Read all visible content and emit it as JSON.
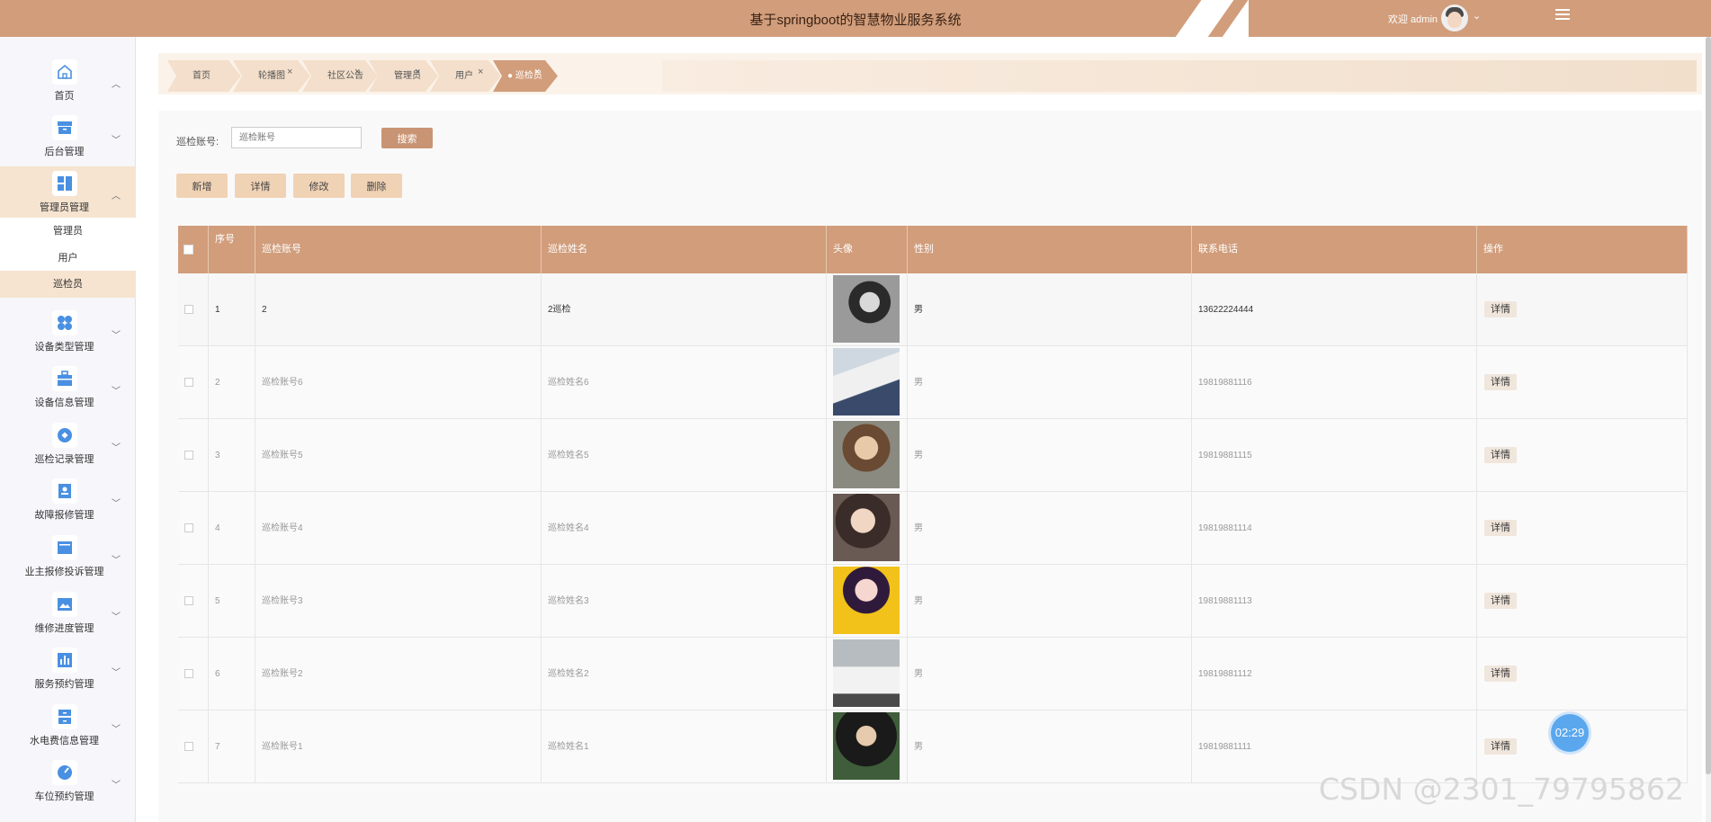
{
  "header": {
    "title": "基于springboot的智慧物业服务系统",
    "welcome": "欢迎 admin"
  },
  "sidebar": {
    "items": [
      {
        "label": "首页",
        "icon": "home-icon",
        "arrow": "^"
      },
      {
        "label": "后台管理",
        "icon": "box-icon",
        "arrow": "v"
      },
      {
        "label": "管理员管理",
        "icon": "grid-icon",
        "arrow": "^"
      },
      {
        "label": "设备类型管理",
        "icon": "dots-grid-icon",
        "arrow": "v"
      },
      {
        "label": "设备信息管理",
        "icon": "briefcase-icon",
        "arrow": "v"
      },
      {
        "label": "巡检记录管理",
        "icon": "target-icon",
        "arrow": "v"
      },
      {
        "label": "故障报修管理",
        "icon": "id-card-icon",
        "arrow": "v"
      },
      {
        "label": "业主报修投诉管理",
        "icon": "window-icon",
        "arrow": "v"
      },
      {
        "label": "维修进度管理",
        "icon": "image-icon",
        "arrow": "v"
      },
      {
        "label": "服务预约管理",
        "icon": "bar-chart-icon",
        "arrow": "v"
      },
      {
        "label": "水电费信息管理",
        "icon": "cabinet-icon",
        "arrow": "v"
      },
      {
        "label": "车位预约管理",
        "icon": "gauge-icon",
        "arrow": "v"
      }
    ],
    "sub_items": [
      "管理员",
      "用户",
      "巡检员"
    ]
  },
  "breadcrumbs": [
    {
      "label": "首页",
      "closable": false
    },
    {
      "label": "轮播图",
      "closable": true
    },
    {
      "label": "社区公告",
      "closable": true
    },
    {
      "label": "管理员",
      "closable": true
    },
    {
      "label": "用户",
      "closable": true
    },
    {
      "label": "● 巡检员",
      "closable": true
    }
  ],
  "search": {
    "label": "巡检账号:",
    "placeholder": "巡检账号",
    "button": "搜索"
  },
  "actions": {
    "add": "新增",
    "detail": "详情",
    "edit": "修改",
    "delete": "删除"
  },
  "table": {
    "headers": [
      "序号",
      "巡检账号",
      "巡检姓名",
      "头像",
      "性别",
      "联系电话",
      "操作"
    ],
    "rows": [
      {
        "index": "1",
        "account": "2",
        "name": "2巡检",
        "gender": "男",
        "phone": "13622224444",
        "action": "详情"
      },
      {
        "index": "2",
        "account": "巡检账号6",
        "name": "巡检姓名6",
        "gender": "男",
        "phone": "19819881116",
        "action": "详情"
      },
      {
        "index": "3",
        "account": "巡检账号5",
        "name": "巡检姓名5",
        "gender": "男",
        "phone": "19819881115",
        "action": "详情"
      },
      {
        "index": "4",
        "account": "巡检账号4",
        "name": "巡检姓名4",
        "gender": "男",
        "phone": "19819881114",
        "action": "详情"
      },
      {
        "index": "5",
        "account": "巡检账号3",
        "name": "巡检姓名3",
        "gender": "男",
        "phone": "19819881113",
        "action": "详情"
      },
      {
        "index": "6",
        "account": "巡检账号2",
        "name": "巡检姓名2",
        "gender": "男",
        "phone": "19819881112",
        "action": "详情"
      },
      {
        "index": "7",
        "account": "巡检账号1",
        "name": "巡检姓名1",
        "gender": "男",
        "phone": "19819881111",
        "action": "详情"
      }
    ]
  },
  "timer": "02:29",
  "watermark": "CSDN @2301_79795862",
  "colors": {
    "brand": "#d19d7b",
    "active_bg": "#f6e4d0",
    "button": "#c99474",
    "timer": "#5aa7ee"
  }
}
